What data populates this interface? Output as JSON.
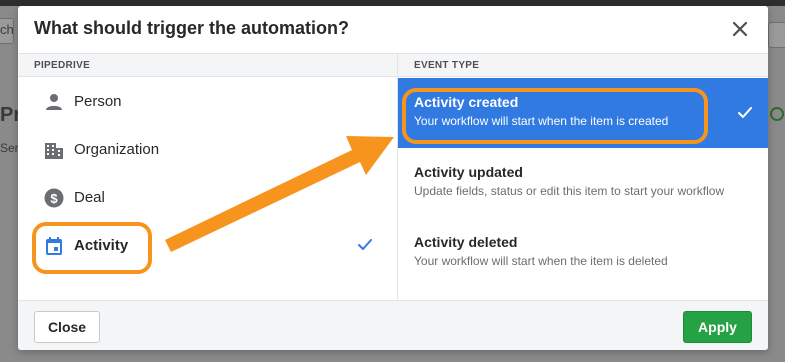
{
  "background": {
    "fragments": {
      "top_left": "ch",
      "heading": "Pri",
      "subtext": "Ser"
    }
  },
  "modal": {
    "title": "What should trigger the automation?",
    "left_header": "PIPEDRIVE",
    "right_header": "EVENT TYPE",
    "entities": [
      {
        "label": "Person",
        "icon": "person-icon",
        "selected": false
      },
      {
        "label": "Organization",
        "icon": "building-icon",
        "selected": false
      },
      {
        "label": "Deal",
        "icon": "dollar-icon",
        "selected": false
      },
      {
        "label": "Activity",
        "icon": "calendar-icon",
        "selected": true
      }
    ],
    "events": [
      {
        "title": "Activity created",
        "description": "Your workflow will start when the item is created",
        "selected": true
      },
      {
        "title": "Activity updated",
        "description": "Update fields, status or edit this item to start your workflow",
        "selected": false
      },
      {
        "title": "Activity deleted",
        "description": "Your workflow will start when the item is deleted",
        "selected": false
      }
    ],
    "close_label": "Close",
    "apply_label": "Apply"
  },
  "colors": {
    "selected_event_bg": "#317ae2",
    "check_blue": "#317ae2",
    "apply_green": "#25a244",
    "annotation_orange": "#f7941d"
  }
}
